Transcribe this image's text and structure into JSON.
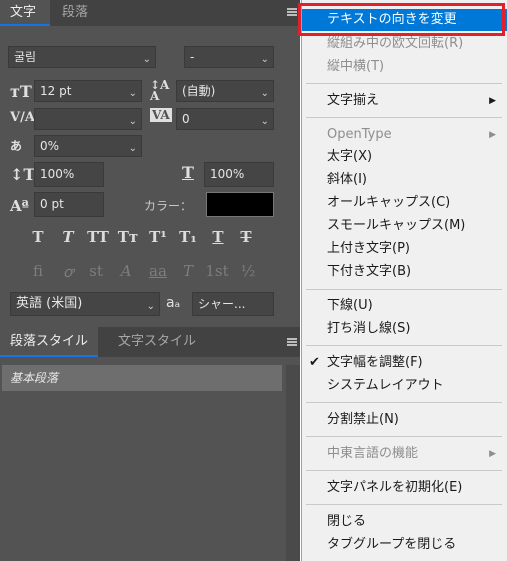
{
  "panel": {
    "tabs": [
      "文字",
      "段落"
    ],
    "font_family": "굴림",
    "font_style": "-",
    "font_size": "12 pt",
    "leading": "(自動)",
    "kerning": "",
    "tracking": "0",
    "tsume": "0%",
    "vertical_scale": "100%",
    "horizontal_scale": "100%",
    "baseline_shift": "0 pt",
    "color_label": "カラー：",
    "color_value": "#000000",
    "style_glyphs": [
      "T",
      "T",
      "TT",
      "Tт",
      "T¹",
      "T₁",
      "T",
      "T"
    ],
    "opentype_glyphs": [
      "fi",
      "ꝍ",
      "st",
      "A",
      "aa",
      "T",
      "1st",
      "½"
    ],
    "language": "英語 (米国)",
    "aa_icon": "aₐ",
    "anti_alias": "シャー..."
  },
  "styles_panel": {
    "tabs": [
      "段落スタイル",
      "文字スタイル"
    ],
    "items": [
      "基本段落"
    ]
  },
  "menu": {
    "items": [
      {
        "label": "テキストの向きを変更",
        "state": "selected"
      },
      {
        "label": "縦組み中の欧文回転(R)",
        "state": "disabled"
      },
      {
        "label": "縦中横(T)",
        "state": "disabled"
      },
      {
        "label": "文字揃え",
        "state": "normal",
        "submenu": true
      },
      {
        "label": "OpenType",
        "state": "disabled",
        "submenu": true
      },
      {
        "label": "太字(X)",
        "state": "normal"
      },
      {
        "label": "斜体(I)",
        "state": "normal"
      },
      {
        "label": "オールキャップス(C)",
        "state": "normal"
      },
      {
        "label": "スモールキャップス(M)",
        "state": "normal"
      },
      {
        "label": "上付き文字(P)",
        "state": "normal"
      },
      {
        "label": "下付き文字(B)",
        "state": "normal"
      },
      {
        "label": "下線(U)",
        "state": "normal"
      },
      {
        "label": "打ち消し線(S)",
        "state": "normal"
      },
      {
        "label": "文字幅を調整(F)",
        "state": "normal",
        "checked": true
      },
      {
        "label": "システムレイアウト",
        "state": "normal"
      },
      {
        "label": "分割禁止(N)",
        "state": "normal"
      },
      {
        "label": "中東言語の機能",
        "state": "disabled",
        "submenu": true
      },
      {
        "label": "文字パネルを初期化(E)",
        "state": "normal"
      },
      {
        "label": "閉じる",
        "state": "normal"
      },
      {
        "label": "タブグループを閉じる",
        "state": "normal"
      }
    ],
    "highlight_color": "#e0202a",
    "selection_color": "#0078d7"
  }
}
